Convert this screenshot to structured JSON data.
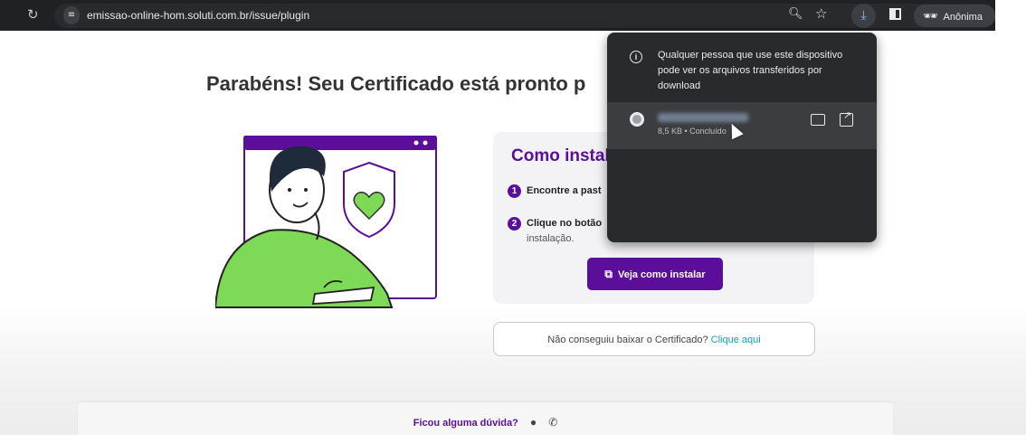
{
  "browser": {
    "url": "emissao-online-hom.soluti.com.br/issue/plugin",
    "profile_label": "Anônima",
    "icons": [
      "reload-icon",
      "site-settings-icon",
      "zoom-icon",
      "bookmark-star-icon",
      "download-icon",
      "side-panel-icon",
      "incognito-icon"
    ]
  },
  "page": {
    "title": "Parabéns! Seu Certificado está pronto p",
    "card": {
      "heading": "Como instal",
      "step1_num": "1",
      "step1_text": "Encontre a past",
      "step2_num": "2",
      "step2_text": "Clique no botão",
      "step2_cont": "instalação.",
      "button_label": "Veja como instalar"
    },
    "help": {
      "text": "Não conseguiu baixar o Certificado?",
      "link": "Clique aqui"
    },
    "footer": {
      "question": "Ficou alguma dúvida?"
    }
  },
  "downloads_popup": {
    "info_text": "Qualquer pessoa que use este dispositivo pode ver os arquivos transferidos por download",
    "file": {
      "name_blurred": "",
      "meta": "8,5 KB • Concluído"
    }
  },
  "colors": {
    "brand_purple": "#5b0e9a",
    "link_teal": "#16a1b8",
    "illus_green": "#7ed957",
    "browser_dark": "#202124"
  }
}
